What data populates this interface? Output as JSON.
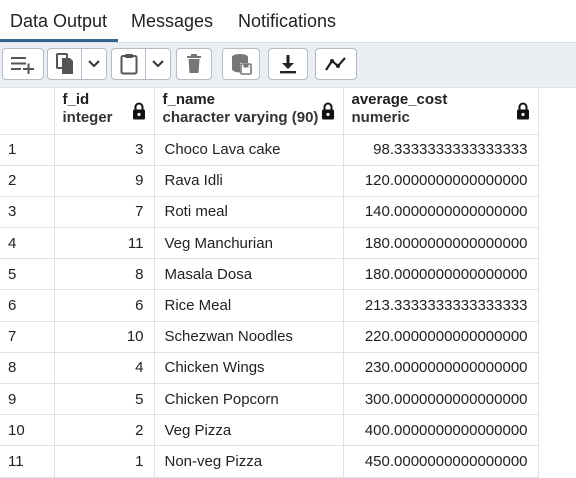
{
  "tabs": [
    {
      "label": "Data Output"
    },
    {
      "label": "Messages"
    },
    {
      "label": "Notifications"
    }
  ],
  "columns": [
    {
      "name": "f_id",
      "type": "integer"
    },
    {
      "name": "f_name",
      "type": "character varying (90)"
    },
    {
      "name": "average_cost",
      "type": "numeric"
    }
  ],
  "rows": [
    {
      "n": "1",
      "f_id": "3",
      "f_name": "Choco Lava cake",
      "average_cost": "98.3333333333333333"
    },
    {
      "n": "2",
      "f_id": "9",
      "f_name": "Rava Idli",
      "average_cost": "120.0000000000000000"
    },
    {
      "n": "3",
      "f_id": "7",
      "f_name": "Roti meal",
      "average_cost": "140.0000000000000000"
    },
    {
      "n": "4",
      "f_id": "11",
      "f_name": "Veg Manchurian",
      "average_cost": "180.0000000000000000"
    },
    {
      "n": "5",
      "f_id": "8",
      "f_name": "Masala Dosa",
      "average_cost": "180.0000000000000000"
    },
    {
      "n": "6",
      "f_id": "6",
      "f_name": "Rice Meal",
      "average_cost": "213.3333333333333333"
    },
    {
      "n": "7",
      "f_id": "10",
      "f_name": "Schezwan Noodles",
      "average_cost": "220.0000000000000000"
    },
    {
      "n": "8",
      "f_id": "4",
      "f_name": "Chicken Wings",
      "average_cost": "230.0000000000000000"
    },
    {
      "n": "9",
      "f_id": "5",
      "f_name": "Chicken Popcorn",
      "average_cost": "300.0000000000000000"
    },
    {
      "n": "10",
      "f_id": "2",
      "f_name": "Veg Pizza",
      "average_cost": "400.0000000000000000"
    },
    {
      "n": "11",
      "f_id": "1",
      "f_name": "Non-veg Pizza",
      "average_cost": "450.0000000000000000"
    }
  ],
  "icons": {
    "add_row": "add-row-icon",
    "copy": "copy-icon",
    "paste": "paste-icon",
    "delete": "delete-icon",
    "save_data": "save-data-icon",
    "download": "download-icon",
    "graph": "graph-icon",
    "lock": "lock-icon"
  },
  "colors": {
    "accent": "#326690",
    "toolbar_bg": "#ebeef3",
    "border": "#dde0e6"
  }
}
